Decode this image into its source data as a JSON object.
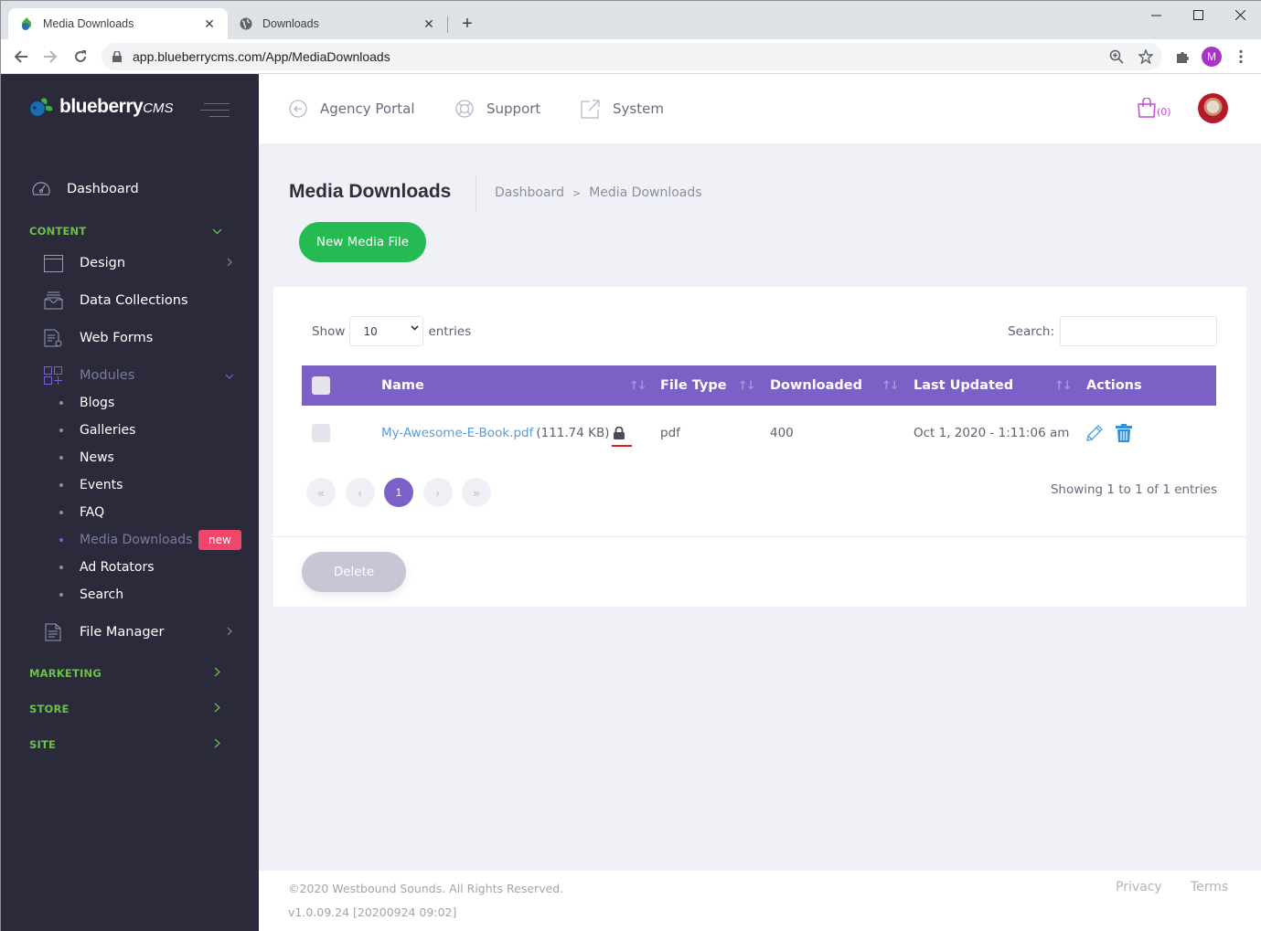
{
  "browser": {
    "tabs": [
      {
        "title": "Media Downloads",
        "icon": "blueberry-favicon",
        "active": true
      },
      {
        "title": "Downloads",
        "icon": "globe-icon",
        "active": false
      }
    ],
    "close_glyph": "✕",
    "new_tab_glyph": "+",
    "url": "app.blueberrycms.com/App/MediaDownloads",
    "profile_initial": "M"
  },
  "app": {
    "brand": {
      "name": "blueberry",
      "suffix": "CMS"
    },
    "sidebar": {
      "dashboard": "Dashboard",
      "sections": {
        "content": "CONTENT",
        "marketing": "MARKETING",
        "store": "STORE",
        "site": "SITE"
      },
      "items": {
        "design": "Design",
        "data_collections": "Data Collections",
        "web_forms": "Web Forms",
        "modules": "Modules",
        "file_manager": "File Manager"
      },
      "modules": [
        {
          "label": "Blogs"
        },
        {
          "label": "Galleries"
        },
        {
          "label": "News"
        },
        {
          "label": "Events"
        },
        {
          "label": "FAQ"
        },
        {
          "label": "Media Downloads",
          "active": true,
          "badge": "new"
        },
        {
          "label": "Ad Rotators"
        },
        {
          "label": "Search"
        }
      ]
    },
    "topbar": {
      "links": [
        "Agency Portal",
        "Support",
        "System"
      ],
      "cart_count": "(0)"
    },
    "page": {
      "title": "Media Downloads",
      "breadcrumb": [
        "Dashboard",
        "Media Downloads"
      ],
      "breadcrumb_sep": ">",
      "new_button": "New Media File"
    },
    "table": {
      "show_label": "Show",
      "entries_label": "entries",
      "page_length": "10",
      "search_label": "Search:",
      "search_value": "",
      "columns": [
        "Name",
        "File Type",
        "Downloaded",
        "Last Updated",
        "Actions"
      ],
      "rows": [
        {
          "name": "My-Awesome-E-Book.pdf",
          "size": "(111.74 KB)",
          "locked": true,
          "file_type": "pdf",
          "downloaded": "400",
          "last_updated": "Oct 1, 2020 - 1:11:06 am"
        }
      ],
      "pagination": {
        "first": "«",
        "prev": "‹",
        "current": "1",
        "next": "›",
        "last": "»"
      },
      "info": "Showing 1 to 1 of 1 entries",
      "delete_button": "Delete"
    },
    "footer": {
      "copyright": "©2020 Westbound Sounds. All Rights Reserved.",
      "version": "v1.0.09.24 [20200924 09:02]",
      "links": [
        "Privacy",
        "Terms"
      ]
    },
    "colors": {
      "sidebar_bg": "#2b2a3b",
      "section_green": "#6cc04a",
      "header_purple": "#7b60c6",
      "primary_green": "#24bb53",
      "badge_red": "#f0466a",
      "link_blue": "#5b9bd6"
    }
  }
}
